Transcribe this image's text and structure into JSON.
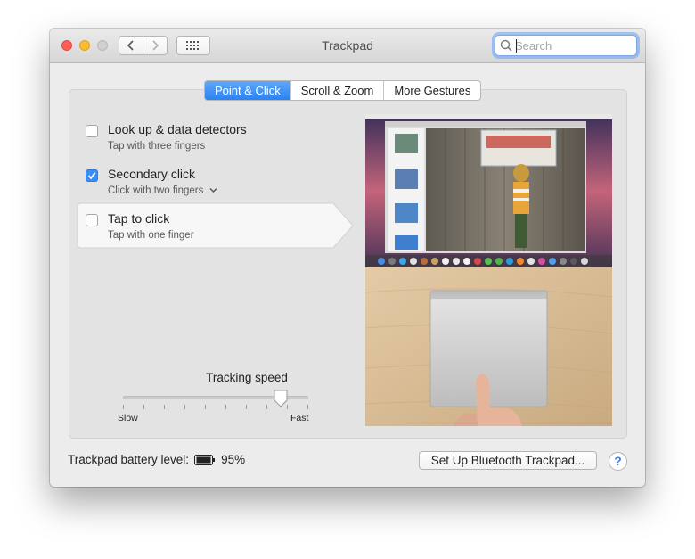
{
  "window": {
    "title": "Trackpad"
  },
  "search": {
    "placeholder": "Search",
    "value": ""
  },
  "tabs": [
    {
      "label": "Point & Click",
      "active": true
    },
    {
      "label": "Scroll & Zoom",
      "active": false
    },
    {
      "label": "More Gestures",
      "active": false
    }
  ],
  "options": [
    {
      "title": "Look up & data detectors",
      "subtitle": "Tap with three fingers",
      "checked": false
    },
    {
      "title": "Secondary click",
      "subtitle": "Click with two fingers",
      "checked": true,
      "has_dropdown": true
    },
    {
      "title": "Tap to click",
      "subtitle": "Tap with one finger",
      "checked": false,
      "selected": true
    }
  ],
  "tracking": {
    "label": "Tracking speed",
    "min_label": "Slow",
    "max_label": "Fast",
    "value_fraction": 0.86,
    "ticks": 10
  },
  "battery": {
    "label": "Trackpad battery level:",
    "value": "95%"
  },
  "setup_button": "Set Up Bluetooth Trackpad...",
  "help_label": "?",
  "colors": {
    "accent": "#2a82f3",
    "checkbox_checked": "#3a8ff7"
  }
}
